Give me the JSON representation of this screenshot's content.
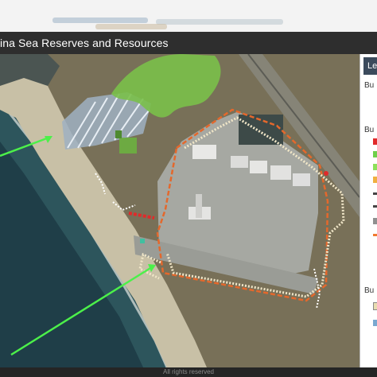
{
  "app": {
    "title": "ina Sea Reserves and Resources"
  },
  "legend": {
    "tab_label": "Le",
    "rows": [
      {
        "label": "Bu"
      },
      {
        "label": "Bu"
      },
      {
        "label": "Bu"
      }
    ],
    "colors": [
      "#e12a2a",
      "#6fd04a",
      "#8de05a",
      "#f0b040",
      "#444444",
      "#909090",
      "#f07a30",
      "#e8dcb0",
      "#7aa8d0"
    ]
  },
  "footer": {
    "attribution": "All rights reserved"
  },
  "map": {
    "colors": {
      "ocean_deep": "#1d3a44",
      "ocean": "#2f5a60",
      "beach": "#c9c2a8",
      "scrub": "#746c56",
      "pavement": "#a9aba5",
      "boundary": "#e4682c",
      "arrow": "#4cf04a",
      "vegetation": "#7ac04a"
    },
    "icons": [
      "arrow-annotation-icon",
      "boundary-polygon"
    ]
  }
}
